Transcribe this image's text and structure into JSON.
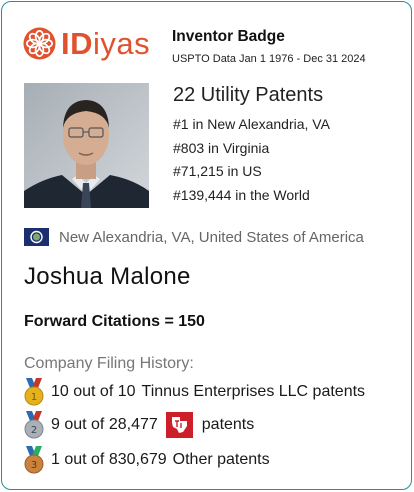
{
  "logo": {
    "bold": "ID",
    "rest": "iyas"
  },
  "header": {
    "title": "Inventor Badge",
    "subtitle": "USPTO Data Jan 1 1976 - Dec 31 2024"
  },
  "stats": {
    "patents": "22 Utility Patents",
    "ranks": [
      "#1 in New Alexandria, VA",
      "#803 in Virginia",
      "#71,215 in US",
      "#139,444 in the World"
    ]
  },
  "location": {
    "flag_icon": "virginia-flag-icon",
    "text": "New Alexandria, VA, United States of America"
  },
  "inventor": {
    "name": "Joshua Malone"
  },
  "citations": {
    "text": "Forward Citations = 150"
  },
  "filing_history": {
    "title": "Company Filing History:",
    "rows": [
      {
        "medal": "gold-medal-icon",
        "count": "10 out of 10",
        "company": "Tinnus Enterprises LLC patents"
      },
      {
        "medal": "silver-medal-icon",
        "count": "9 out of 28,477",
        "company_logo": "texas-instruments-logo-icon",
        "suffix": "patents"
      },
      {
        "medal": "bronze-medal-icon",
        "count": "1 out of 830,679",
        "company": "Other patents"
      }
    ]
  },
  "colors": {
    "brand": "#e0522f",
    "border": "#2e8b96",
    "gold": "#e3b21d",
    "silver": "#a9b0b8",
    "bronze": "#c9833f",
    "ti_red": "#cc1f2a"
  }
}
